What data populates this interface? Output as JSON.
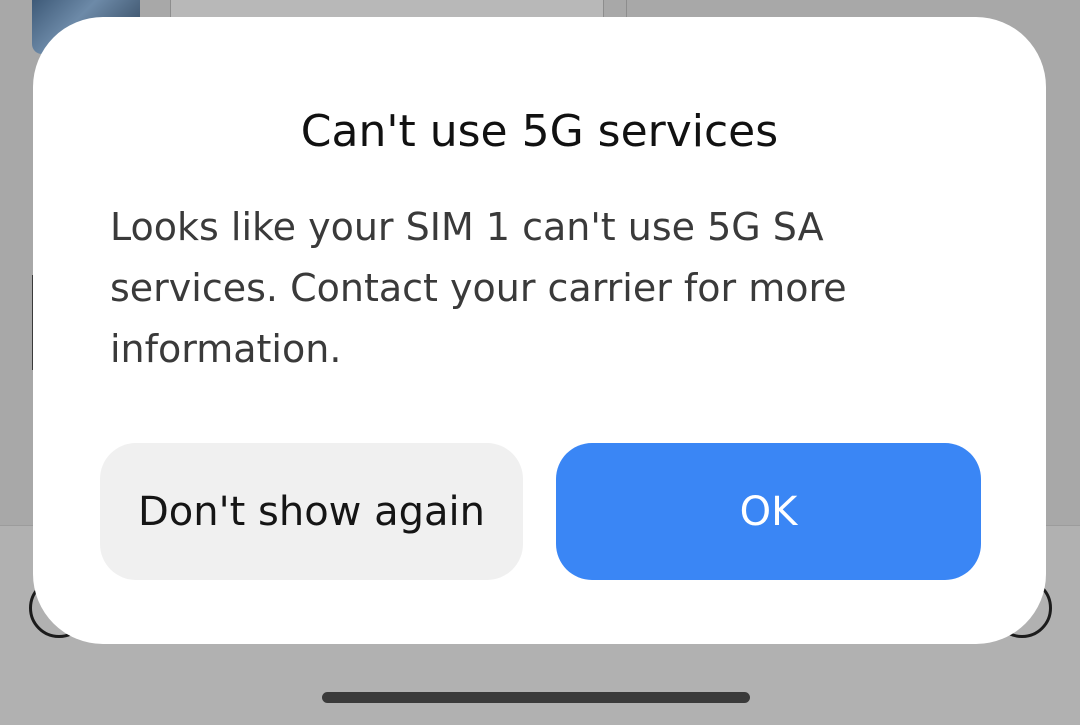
{
  "dialog": {
    "title": "Can't use 5G services",
    "message": "Looks like your SIM 1 can't use 5G SA services. Contact your carrier for more information.",
    "secondary_button_label": "Don't show again",
    "primary_button_label": "OK"
  },
  "colors": {
    "primary_button": "#3a86f5",
    "secondary_button": "#f0f0f0",
    "scrim": "#a9a9a9",
    "dialog_background": "#ffffff"
  }
}
